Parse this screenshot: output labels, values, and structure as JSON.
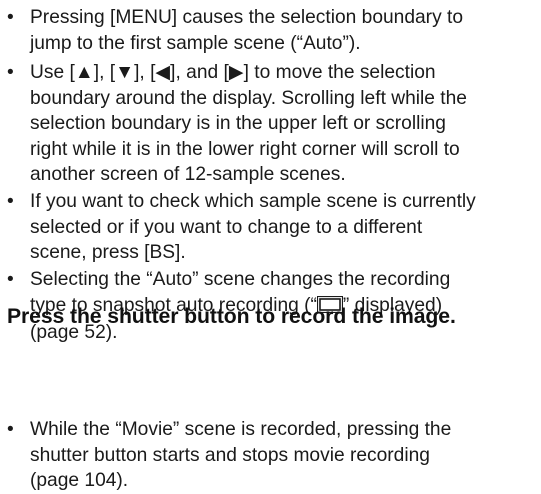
{
  "bullets_top": [
    {
      "lines": [
        "Pressing [MENU] causes the selection boundary to",
        "jump to the first sample scene (“Auto”)."
      ]
    },
    {
      "lines": [
        "Use [▲], [▼], [◀], and [▶] to move the selection",
        "boundary around the display. Scrolling left while the",
        "selection boundary is in the upper left or scrolling",
        "right while it is in the lower right corner will scroll to",
        "another screen of 12-sample scenes."
      ]
    },
    {
      "lines": [
        "If you want to check which sample scene is currently",
        "selected or if you want to change to a different",
        "scene, press [BS]."
      ]
    },
    {
      "line1": "Selecting the “Auto” scene changes the recording",
      "line2_before_icon": "type to snapshot auto recording (“",
      "line2_icon": "snapshot-mode-icon",
      "line2_after_icon": "” displayed)",
      "line3": "(page 52)."
    }
  ],
  "heading": "Press the shutter button to record the image.",
  "bullets_bottom": [
    {
      "lines": [
        "While the “Movie” scene is recorded, pressing the",
        "shutter button starts and stops movie recording",
        "(page 104)."
      ]
    }
  ],
  "bullet_symbol": "•"
}
